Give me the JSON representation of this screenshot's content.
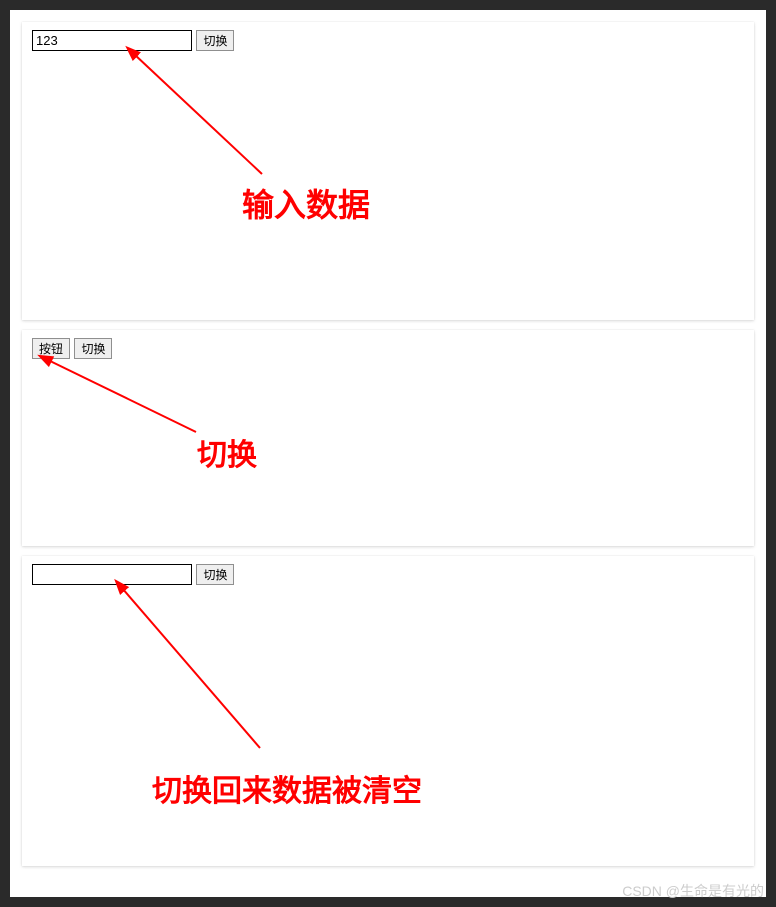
{
  "panel1": {
    "input_value": "123",
    "toggle_label": "切换",
    "annotation": "输入数据"
  },
  "panel2": {
    "button_label": "按钮",
    "toggle_label": "切换",
    "annotation": "切换"
  },
  "panel3": {
    "input_value": "",
    "toggle_label": "切换",
    "annotation": "切换回来数据被清空"
  },
  "watermark": "CSDN @生命是有光的",
  "colors": {
    "annotation": "#ff0000",
    "panel_bg": "#ffffff",
    "body_bg": "#2a2a2a"
  }
}
